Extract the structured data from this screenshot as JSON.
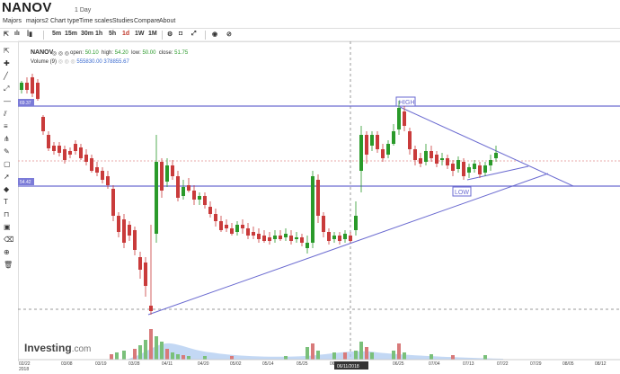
{
  "title": "NANOV",
  "period": "1 Day",
  "menu": [
    "Majors",
    "majors2",
    "Chart type",
    "Time scales",
    "Studies",
    "Compare",
    "About"
  ],
  "toolbar": {
    "intervals": [
      "5m",
      "15m",
      "30m",
      "1h",
      "5h",
      "1d",
      "1W",
      "1M"
    ]
  },
  "legend": {
    "symbol": "NANOV",
    "open_label": "open:",
    "open": "50.10",
    "high_label": "high:",
    "high": "54.20",
    "low_label": "low:",
    "low": "50.00",
    "close_label": "close:",
    "close": "51.75",
    "volume_label": "Volume (9)",
    "volume_values": "555830.00 378855.67"
  },
  "price_tags": [
    "69.37",
    "54.42"
  ],
  "annotations": {
    "high": "HIGH",
    "low": "LOW"
  },
  "date_axis": {
    "first_month": "02/22",
    "first_year": "2018",
    "ticks": [
      "03/08",
      "03/19",
      "03/28",
      "04/11",
      "04/20",
      "05/02",
      "05/14",
      "05/25",
      "06/",
      "06/25",
      "07/04",
      "07/13",
      "07/22",
      "07/29",
      "08/05",
      "08/12"
    ],
    "crosshair_date": "06/11/2018"
  },
  "logo": {
    "main": "Investing",
    "suffix": ".com"
  },
  "colors": {
    "up": "#2a9a2a",
    "down": "#c93b3b",
    "line": "#6a6ad0",
    "tag": "#7b7bd8",
    "volume_area": "#a9c7ef"
  }
}
